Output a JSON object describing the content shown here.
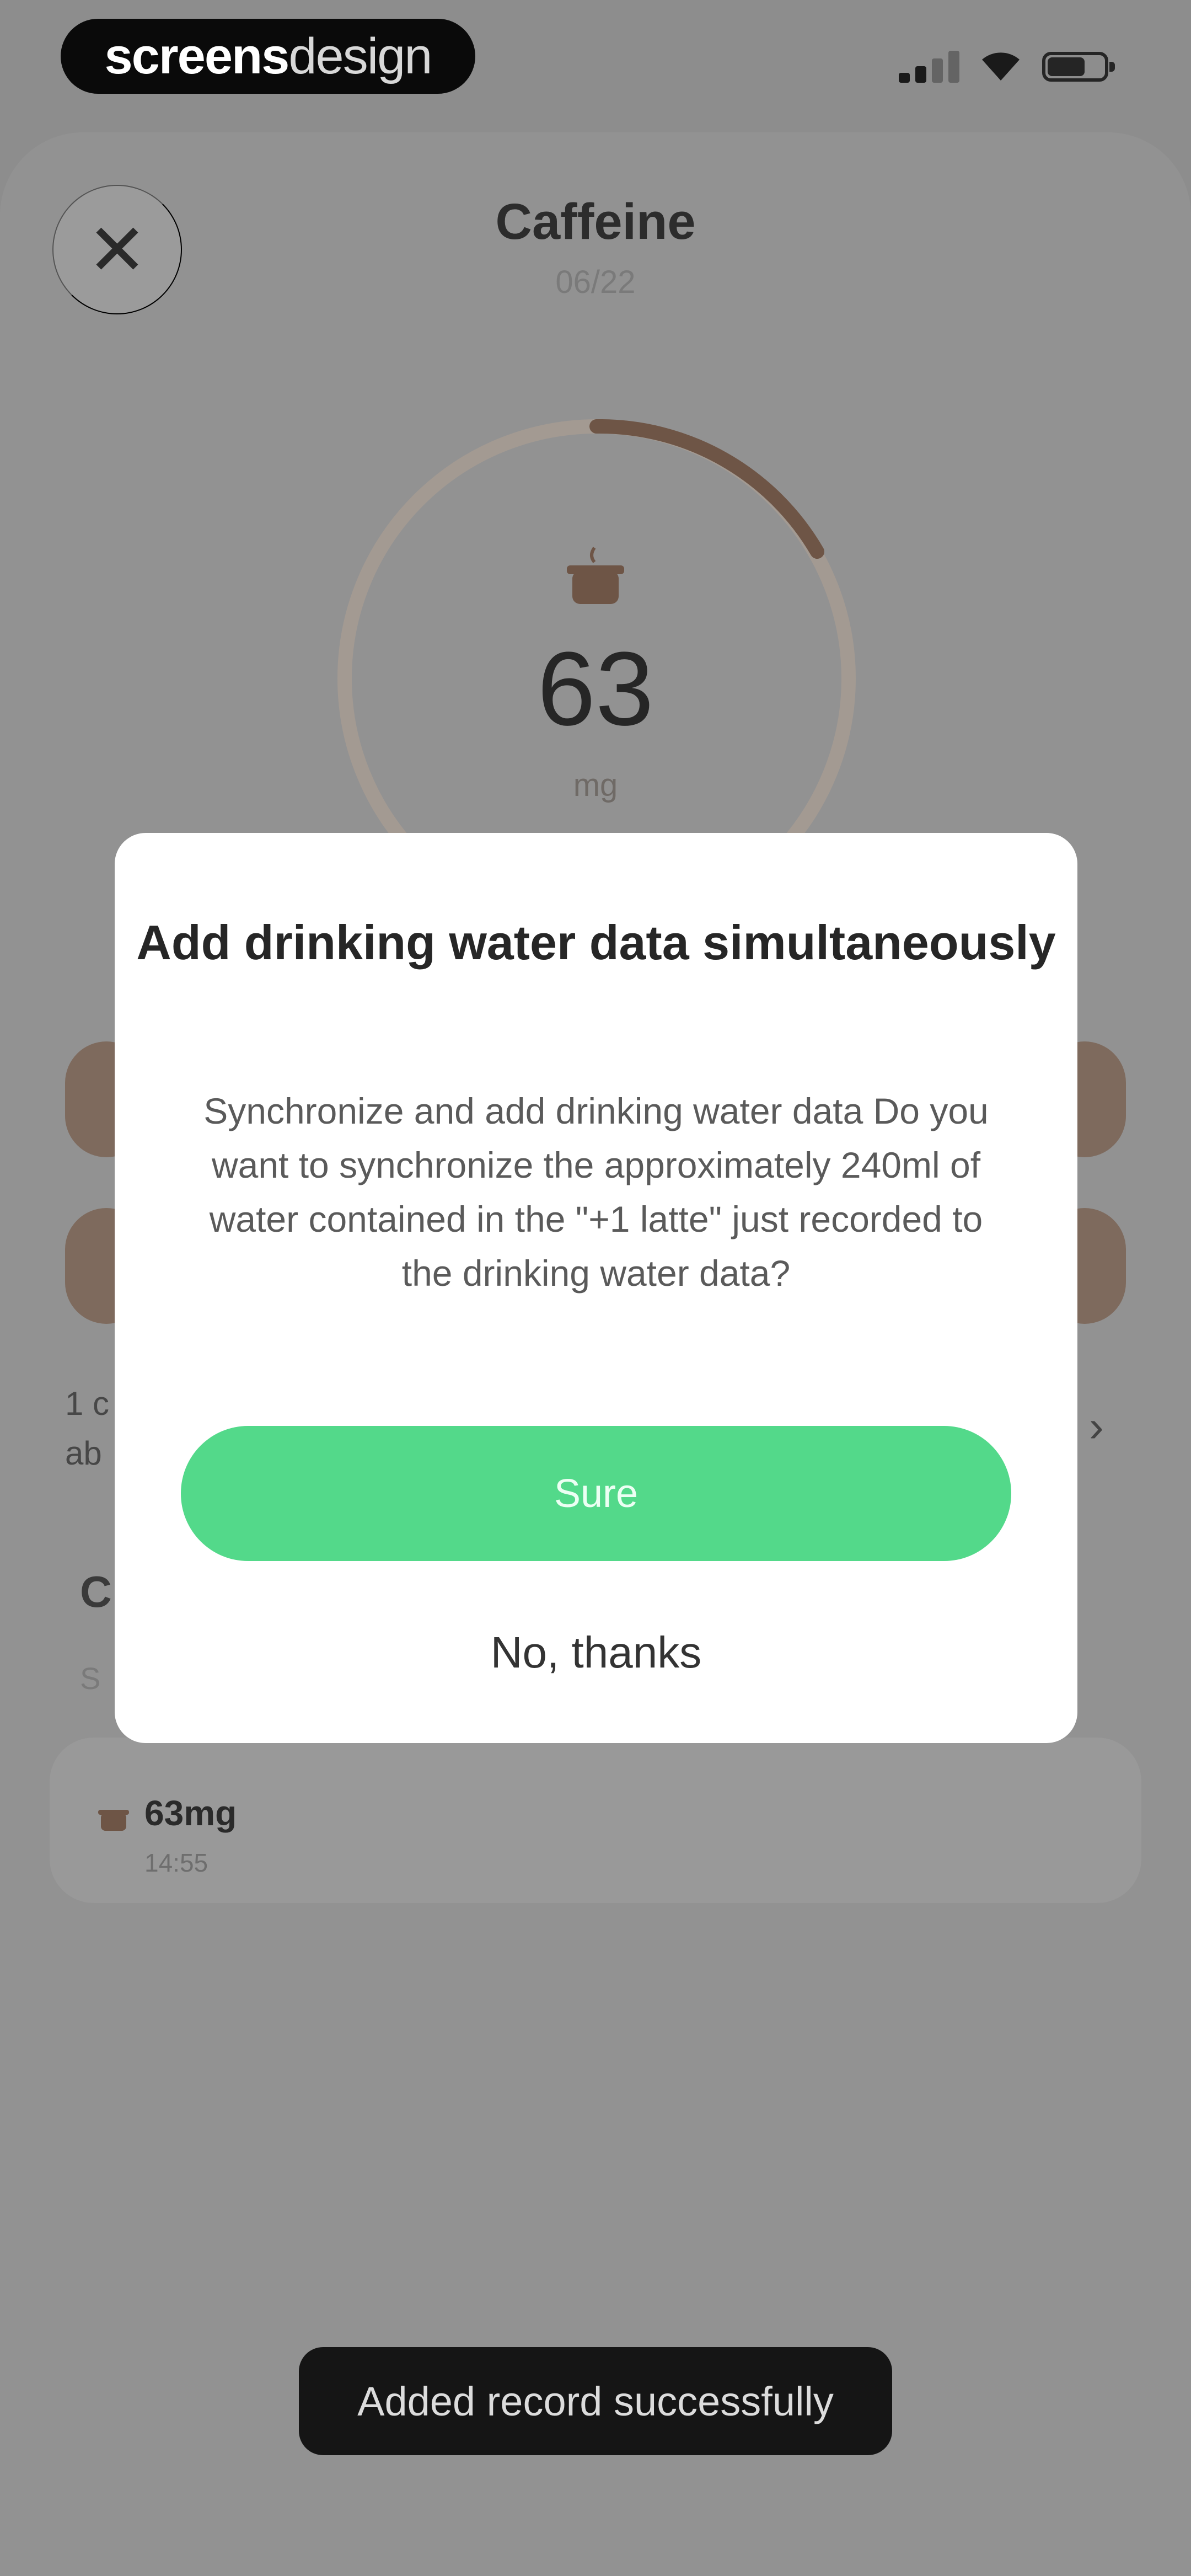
{
  "status_bar": {
    "brand_bold": "screens",
    "brand_light": "design"
  },
  "header": {
    "title": "Caffeine",
    "date": "06/22",
    "close_icon": "✕"
  },
  "summary": {
    "value": "63",
    "unit": "mg",
    "icon": "coffee-cup-icon"
  },
  "background_rows": {
    "note_line1": "1 c",
    "note_line2": "ab"
  },
  "section": {
    "title_fragment": "C",
    "subtitle_fragment": "S"
  },
  "record": {
    "amount": "63mg",
    "time": "14:55"
  },
  "dialog": {
    "title": "Add drinking water data simultaneously",
    "body": "Synchronize and add drinking water data Do you want to synchronize the approximately 240ml of water contained in the \"+1 latte\" just recorded to the drinking water data?",
    "confirm_label": "Sure",
    "cancel_label": "No, thanks"
  },
  "toast": {
    "text": "Added record successfully"
  },
  "colors": {
    "accent_green": "#53d98a",
    "coffee_brown": "#7e6a5d",
    "overlay_gray": "#8d8d8d"
  }
}
